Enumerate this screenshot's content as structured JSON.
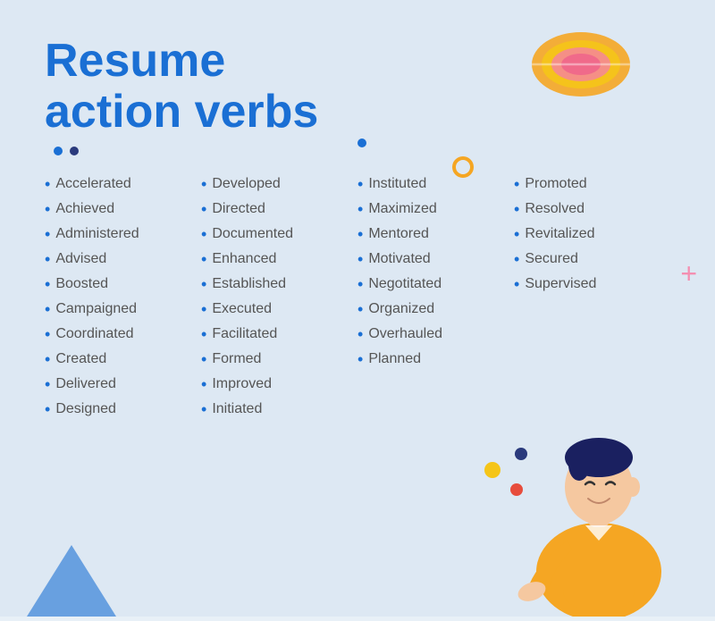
{
  "title": {
    "line1": "Resume",
    "line2": "action verbs"
  },
  "columns": [
    {
      "id": "col1",
      "verbs": [
        "Accelerated",
        "Achieved",
        "Administered",
        "Advised",
        "Boosted",
        "Campaigned",
        "Coordinated",
        "Created",
        "Delivered",
        "Designed"
      ]
    },
    {
      "id": "col2",
      "verbs": [
        "Developed",
        "Directed",
        "Documented",
        "Enhanced",
        "Established",
        "Executed",
        "Facilitated",
        "Formed",
        "Improved",
        "Initiated"
      ]
    },
    {
      "id": "col3",
      "verbs": [
        "Instituted",
        "Maximized",
        "Mentored",
        "Motivated",
        "Negotitated",
        "Organized",
        "Overhauled",
        "Planned"
      ]
    },
    {
      "id": "col4",
      "verbs": [
        "Promoted",
        "Resolved",
        "Revitalized",
        "Secured",
        "Supervised"
      ]
    }
  ],
  "decorative": {
    "plus_symbol": "+",
    "dot_label1": "blue-dot",
    "dot_label2": "navy-dot"
  }
}
